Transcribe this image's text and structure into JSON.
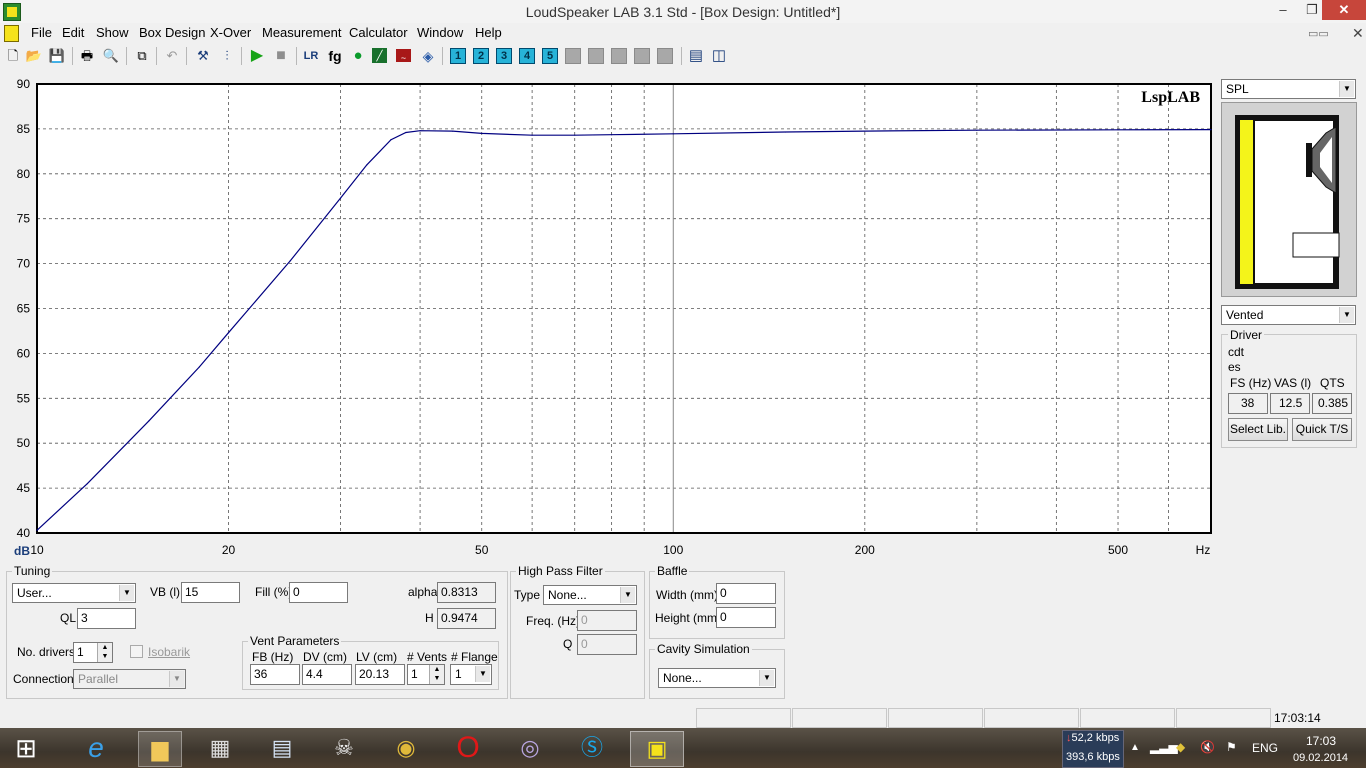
{
  "window": {
    "title": "LoudSpeaker LAB 3.1 Std - [Box Design: Untitled*]",
    "min_glyph": "–",
    "max_glyph": "❐",
    "close_glyph": "✕",
    "mdi_close": "✕"
  },
  "menu": [
    "File",
    "Edit",
    "Show",
    "Box Design",
    "X-Over",
    "Measurement",
    "Calculator",
    "Window",
    "Help"
  ],
  "toolbar": {
    "icons": [
      "new-icon",
      "open-icon",
      "save-icon",
      "print-icon",
      "print-preview-icon",
      "copy-icon",
      "undo-icon",
      "tools-icon",
      "equalizer-icon",
      "play-icon",
      "stop-icon",
      "lr-icon",
      "fg-icon",
      "circle-icon",
      "graph-icon",
      "impedance-icon",
      "shield-icon"
    ],
    "lr_label": "LR",
    "fg_label": "fg",
    "numbered": [
      "1",
      "2",
      "3",
      "4",
      "5"
    ]
  },
  "chart_data": {
    "type": "line",
    "watermark": "LspLAB",
    "xlabel": "Hz",
    "ylabel": "dB",
    "x_scale": "log",
    "xlim": [
      10,
      700
    ],
    "ylim": [
      40,
      90
    ],
    "y_ticks": [
      90,
      85,
      80,
      75,
      70,
      65,
      60,
      55,
      50,
      45,
      40
    ],
    "x_ticks": [
      10,
      20,
      50,
      100,
      200,
      500
    ],
    "grid": true,
    "series": [
      {
        "color": "#000080",
        "x": [
          10,
          12,
          15,
          18,
          20,
          25,
          30,
          33,
          36,
          38,
          40,
          45,
          50,
          60,
          70,
          80,
          100,
          150,
          200,
          300,
          500,
          700
        ],
        "y": [
          40.3,
          45.5,
          52.5,
          58.5,
          62.3,
          70.3,
          77.3,
          81.0,
          83.8,
          84.6,
          84.8,
          84.75,
          84.5,
          84.3,
          84.3,
          84.35,
          84.45,
          84.65,
          84.75,
          84.85,
          84.9,
          84.92
        ]
      }
    ]
  },
  "panel": {
    "response_select": "SPL",
    "box_type": "Vented",
    "driver": {
      "group_label": "Driver",
      "name_line1": "cdt",
      "name_line2": "es",
      "fs_label": "FS (Hz)",
      "vas_label": "VAS (l)",
      "qts_label": "QTS",
      "fs": "38",
      "vas": "12.5",
      "qts": "0.385",
      "select_lib": "Select Lib.",
      "quick_ts": "Quick T/S"
    }
  },
  "tuning": {
    "group_label": "Tuning",
    "mode": "User...",
    "vb_label": "VB (l)",
    "vb": "15",
    "fill_label": "Fill (%)",
    "fill": "0",
    "alpha_label": "alpha",
    "alpha": "0.8313",
    "h_label": "H",
    "h": "0.9474",
    "ql_label": "QL",
    "ql": "3",
    "drivers_label": "No. drivers",
    "drivers": "1",
    "isobarik": "Isobarik",
    "connection_label": "Connection",
    "connection": "Parallel"
  },
  "vent": {
    "group_label": "Vent Parameters",
    "fb_label": "FB (Hz)",
    "dv_label": "DV (cm)",
    "lv_label": "LV (cm)",
    "vents_label": "# Vents",
    "flange_label": "# Flange",
    "fb": "36",
    "dv": "4.4",
    "lv": "20.13",
    "vents": "1",
    "flange": "1"
  },
  "hpf": {
    "group_label": "High Pass Filter",
    "type_label": "Type",
    "type": "None...",
    "freq_label": "Freq. (Hz)",
    "freq": "0",
    "q_label": "Q",
    "q": "0"
  },
  "baffle": {
    "group_label": "Baffle",
    "width_label": "Width (mm)",
    "width": "0",
    "height_label": "Height (mm)",
    "height": "0"
  },
  "cavity": {
    "group_label": "Cavity Simulation",
    "value": "None..."
  },
  "status": {
    "time": "17:03:14"
  },
  "taskbar": {
    "apps": [
      "windows-start-icon",
      "internet-explorer-icon",
      "file-explorer-icon",
      "archive-icon",
      "calculator-icon",
      "alien-icon",
      "chrome-icon",
      "opera-icon",
      "network-app-icon",
      "skype-icon",
      "loudspeaker-lab-icon"
    ],
    "net_down": "52,2 kbps",
    "net_up": "393,6 kbps",
    "lang": "ENG",
    "clock_time": "17:03",
    "clock_date": "09.02.2014"
  }
}
